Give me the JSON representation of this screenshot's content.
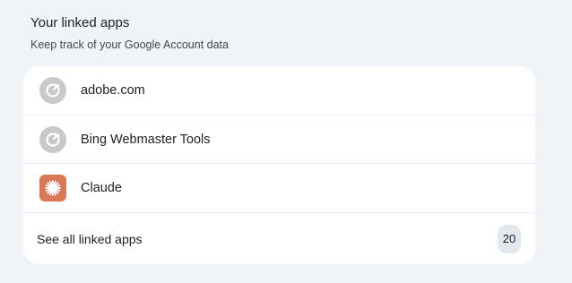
{
  "section": {
    "title": "Your linked apps",
    "subtitle": "Keep track of your Google Account data"
  },
  "apps": [
    {
      "label": "adobe.com",
      "icon": "linked-app-generic-icon"
    },
    {
      "label": "Bing Webmaster Tools",
      "icon": "linked-app-generic-icon"
    },
    {
      "label": "Claude",
      "icon": "claude-logo-icon"
    }
  ],
  "see_all": {
    "label": "See all linked apps",
    "count": "20"
  },
  "colors": {
    "background": "#f0f4f9",
    "card": "#ffffff",
    "generic_icon": "#c8c9cb",
    "claude_brand": "#d97757",
    "badge": "#e3e8ef"
  }
}
